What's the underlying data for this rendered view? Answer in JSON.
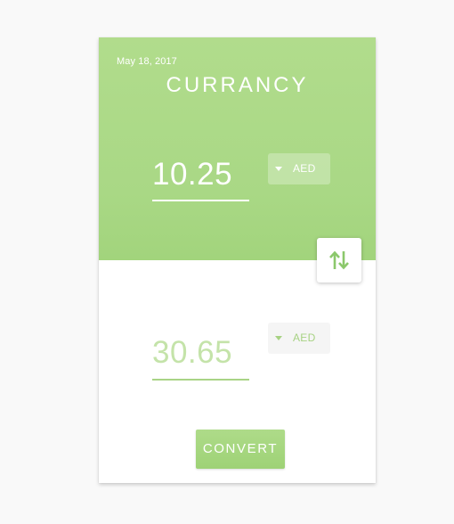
{
  "header": {
    "date": "May 18, 2017",
    "title": "CURRANCY"
  },
  "from": {
    "amount": "10.25",
    "currency": "AED"
  },
  "to": {
    "amount": "30.65",
    "currency": "AED"
  },
  "swap": {
    "icon": "swap-vertical-arrows-icon"
  },
  "actions": {
    "convert_label": "CONVERT"
  },
  "colors": {
    "accent": "#a9d885",
    "accent_light": "#c4e3a9",
    "background": "#f9f9f9"
  }
}
